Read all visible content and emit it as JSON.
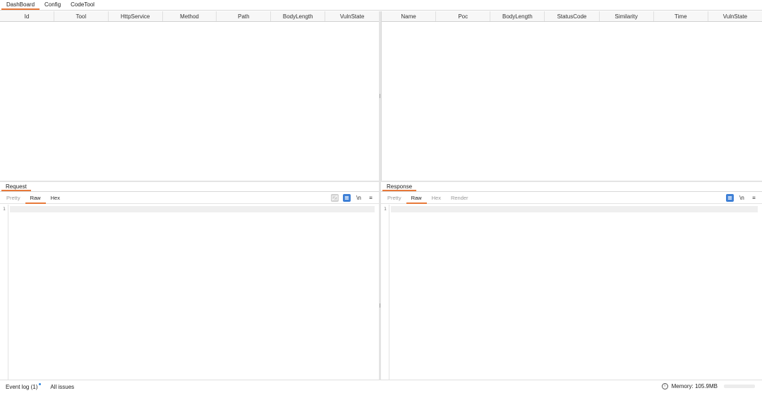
{
  "tabs": [
    "DashBoard",
    "Config",
    "CodeTool"
  ],
  "left_table": {
    "columns": [
      "Id",
      "Tool",
      "HttpService",
      "Method",
      "Path",
      "BodyLength",
      "VulnState"
    ]
  },
  "right_table": {
    "columns": [
      "Name",
      "Poc",
      "BodyLength",
      "StatusCode",
      "Similarity",
      "Time",
      "VulnState"
    ]
  },
  "request": {
    "tab": "Request",
    "modes": [
      "Pretty",
      "Raw",
      "Hex"
    ],
    "active_mode": "Raw",
    "tools": {
      "wrap": "\\n",
      "menu": "≡"
    },
    "line_number": "1"
  },
  "response": {
    "tab": "Response",
    "modes": [
      "Pretty",
      "Raw",
      "Hex",
      "Render"
    ],
    "active_mode": "Raw",
    "tools": {
      "wrap": "\\n",
      "menu": "≡"
    },
    "line_number": "1"
  },
  "status": {
    "event_log": "Event log (1)",
    "all_issues": "All issues",
    "memory": "Memory: 105.9MB"
  },
  "colors": {
    "accent": "#e8793a",
    "blue": "#3d7fd6"
  }
}
